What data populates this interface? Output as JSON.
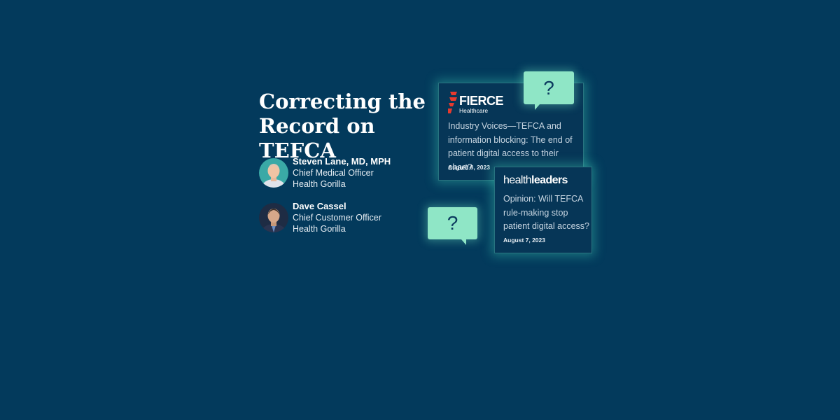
{
  "title_line1": "Correcting the",
  "title_line2": "Record on TEFCA",
  "speakers": [
    {
      "name": "Steven Lane, MD, MPH",
      "role": "Chief Medical Officer",
      "org": "Health Gorilla"
    },
    {
      "name": "Dave Cassel",
      "role": "Chief Customer Officer",
      "org": "Health Gorilla"
    }
  ],
  "card1": {
    "logo_main": "FIERCE",
    "logo_sub": "Healthcare",
    "headline": "Industry Voices—TEFCA and information blocking: The end of patient digital access to their chart?",
    "date": "August 8, 2023"
  },
  "card2": {
    "logo_a": "health",
    "logo_b": "leaders",
    "headline": "Opinion: Will TEFCA rule-making stop patient digital access?",
    "date": "August 7, 2023"
  },
  "bubble_text": "?",
  "colors": {
    "background": "#033a5c",
    "accent": "#8fe6c6",
    "fierce_red": "#e63a2e"
  }
}
